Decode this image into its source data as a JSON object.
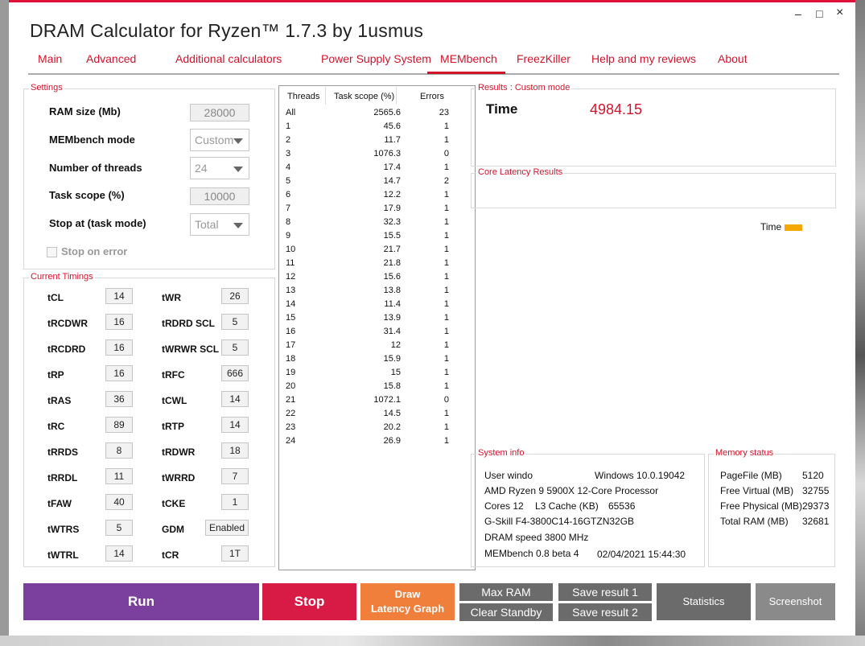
{
  "window": {
    "title": "DRAM Calculator for Ryzen™ 1.7.3 by 1usmus",
    "controls": {
      "minimize": "–",
      "maximize": "□",
      "close": "×"
    }
  },
  "nav": [
    "Main",
    "Advanced",
    "Additional calculators",
    "Power Supply System",
    "MEMbench",
    "FreezKiller",
    "Help and my reviews",
    "About"
  ],
  "nav_active": "MEMbench",
  "settings": {
    "title": "Settings",
    "ram_size_label": "RAM size (Mb)",
    "ram_size_value": "28000",
    "mode_label": "MEMbench mode",
    "mode_value": "Custom",
    "threads_label": "Number of threads",
    "threads_value": "24",
    "task_scope_label": "Task scope (%)",
    "task_scope_value": "10000",
    "stop_at_label": "Stop at (task mode)",
    "stop_at_value": "Total",
    "stop_on_error_label": "Stop on error"
  },
  "timings": {
    "title": "Current Timings",
    "left": [
      {
        "name": "tCL",
        "value": "14"
      },
      {
        "name": "tRCDWR",
        "value": "16"
      },
      {
        "name": "tRCDRD",
        "value": "16"
      },
      {
        "name": "tRP",
        "value": "16"
      },
      {
        "name": "tRAS",
        "value": "36"
      },
      {
        "name": "tRC",
        "value": "89"
      },
      {
        "name": "tRRDS",
        "value": "8"
      },
      {
        "name": "tRRDL",
        "value": "11"
      },
      {
        "name": "tFAW",
        "value": "40"
      },
      {
        "name": "tWTRS",
        "value": "5"
      },
      {
        "name": "tWTRL",
        "value": "14"
      }
    ],
    "right": [
      {
        "name": "tWR",
        "value": "26"
      },
      {
        "name": "tRDRD SCL",
        "value": "5"
      },
      {
        "name": "tWRWR SCL",
        "value": "5"
      },
      {
        "name": "tRFC",
        "value": "666"
      },
      {
        "name": "tCWL",
        "value": "14"
      },
      {
        "name": "tRTP",
        "value": "14"
      },
      {
        "name": "tRDWR",
        "value": "18"
      },
      {
        "name": "tWRRD",
        "value": "7"
      },
      {
        "name": "tCKE",
        "value": "1"
      },
      {
        "name": "GDM",
        "value": "Enabled"
      },
      {
        "name": "tCR",
        "value": "1T"
      }
    ]
  },
  "threads_table": {
    "headers": [
      "Threads",
      "Task scope (%)",
      "Errors"
    ],
    "rows": [
      [
        "All",
        "2565.6",
        "23"
      ],
      [
        "1",
        "45.6",
        "1"
      ],
      [
        "2",
        "11.7",
        "1"
      ],
      [
        "3",
        "1076.3",
        "0"
      ],
      [
        "4",
        "17.4",
        "1"
      ],
      [
        "5",
        "14.7",
        "2"
      ],
      [
        "6",
        "12.2",
        "1"
      ],
      [
        "7",
        "17.9",
        "1"
      ],
      [
        "8",
        "32.3",
        "1"
      ],
      [
        "9",
        "15.5",
        "1"
      ],
      [
        "10",
        "21.7",
        "1"
      ],
      [
        "11",
        "21.8",
        "1"
      ],
      [
        "12",
        "15.6",
        "1"
      ],
      [
        "13",
        "13.8",
        "1"
      ],
      [
        "14",
        "11.4",
        "1"
      ],
      [
        "15",
        "13.9",
        "1"
      ],
      [
        "16",
        "31.4",
        "1"
      ],
      [
        "17",
        "12",
        "1"
      ],
      [
        "18",
        "15.9",
        "1"
      ],
      [
        "19",
        "15",
        "1"
      ],
      [
        "20",
        "15.8",
        "1"
      ],
      [
        "21",
        "1072.1",
        "0"
      ],
      [
        "22",
        "14.5",
        "1"
      ],
      [
        "23",
        "20.2",
        "1"
      ],
      [
        "24",
        "26.9",
        "1"
      ]
    ]
  },
  "results": {
    "title": "Results : Custom mode",
    "time_label": "Time",
    "time_value": "4984.15"
  },
  "core_latency": {
    "title": "Core Latency Results",
    "legend_label": "Time",
    "legend_color": "#f5a800"
  },
  "system_info": {
    "title": "System info",
    "user_label": "User windo",
    "os": "Windows 10.0.19042",
    "cpu": "AMD Ryzen 9 5900X 12-Core Processor",
    "cores": "Cores 12",
    "l3_label": "L3 Cache (KB)",
    "l3_value": "65536",
    "memory": "G-Skill F4-3800C14-16GTZN32GB",
    "dram_speed": "DRAM speed 3800 MHz",
    "membench": "MEMbench 0.8 beta 4",
    "timestamp": "02/04/2021 15:44:30"
  },
  "memory_status": {
    "title": "Memory status",
    "items": [
      {
        "label": "PageFile (MB)",
        "value": "5120"
      },
      {
        "label": "Free Virtual (MB)",
        "value": "32755"
      },
      {
        "label": "Free Physical (MB)",
        "value": "29373"
      },
      {
        "label": "Total RAM (MB)",
        "value": "32681"
      }
    ]
  },
  "buttons": {
    "run": "Run",
    "stop": "Stop",
    "draw_latency_1": "Draw",
    "draw_latency_2": "Latency Graph",
    "max_ram": "Max RAM",
    "clear_standby": "Clear Standby",
    "save1": "Save result 1",
    "save2": "Save result 2",
    "statistics": "Statistics",
    "screenshot": "Screenshot"
  },
  "colors": {
    "accent": "#d2142a",
    "run": "#7b3f9e",
    "stop": "#d81b45",
    "draw": "#f07f3c",
    "gray_btn": "#6b6b6b",
    "screenshot": "#8a8a8a"
  }
}
